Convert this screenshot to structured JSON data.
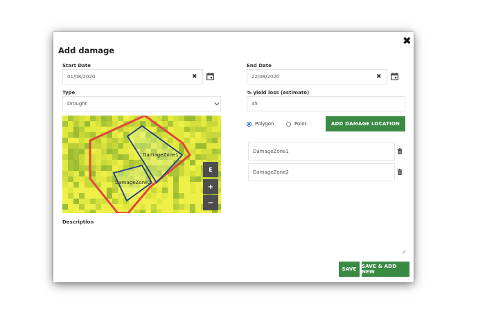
{
  "dialog": {
    "title": "Add damage",
    "close_icon": "close-icon"
  },
  "form": {
    "start_date_label": "Start Date",
    "start_date_value": "01/08/2020",
    "end_date_label": "End Date",
    "end_date_value": "22/08/2020",
    "type_label": "Type",
    "type_value": "Drought",
    "yield_label": "% yield loss (estimate)",
    "yield_value": "45",
    "description_label": "Description",
    "description_value": ""
  },
  "location": {
    "options": [
      {
        "label": "Polygon",
        "selected": true
      },
      {
        "label": "Point",
        "selected": false
      }
    ],
    "add_button": "ADD DAMAGE LOCATION",
    "zones": [
      {
        "name": "DamageZone1"
      },
      {
        "name": "DamageZone2"
      }
    ]
  },
  "map": {
    "zone_labels": [
      "DamageZone1",
      "DamageZone2"
    ],
    "controls": {
      "edit": "E",
      "zoom_in": "+",
      "zoom_out": "−"
    },
    "field_boundary_color": "#e2453b",
    "zone_outline_color": "#1f3d8c"
  },
  "actions": {
    "save": "SAVE",
    "save_add_new": "SAVE & ADD NEW"
  },
  "colors": {
    "primary_button": "#3a8a44"
  }
}
